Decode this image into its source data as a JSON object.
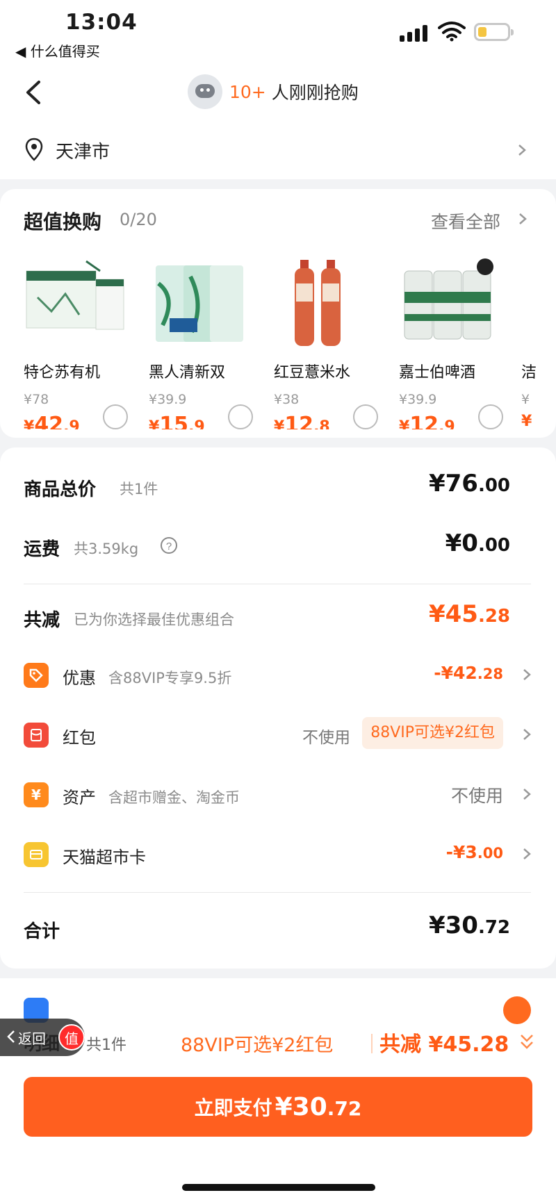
{
  "status_bar": {
    "time": "13:04",
    "back_app": "◀ 什么值得买"
  },
  "nav": {
    "count": "10+",
    "text": "人刚刚抢购"
  },
  "address": {
    "city": "天津市"
  },
  "exchange": {
    "title": "超值换购",
    "counter": "0/20",
    "view_all": "查看全部",
    "products": [
      {
        "name": "特仑苏有机",
        "orig": "¥78",
        "currency": "¥",
        "price_int": "42",
        "price_dec": ".9"
      },
      {
        "name": "黑人清新双",
        "orig": "¥39.9",
        "currency": "¥",
        "price_int": "15",
        "price_dec": ".9"
      },
      {
        "name": "红豆薏米水",
        "orig": "¥38",
        "currency": "¥",
        "price_int": "12",
        "price_dec": ".8"
      },
      {
        "name": "嘉士伯啤酒",
        "orig": "¥39.9",
        "currency": "¥",
        "price_int": "12",
        "price_dec": ".9"
      },
      {
        "name": "洁",
        "orig": "¥",
        "currency": "¥",
        "price_int": "",
        "price_dec": ""
      }
    ]
  },
  "summary": {
    "goods_total": {
      "label": "商品总价",
      "sub": "共1件",
      "amt_int": "¥76",
      "amt_dec": ".00"
    },
    "shipping": {
      "label": "运费",
      "sub": "共3.59kg",
      "amt_int": "¥0",
      "amt_dec": ".00"
    },
    "total_reduce": {
      "label": "共减",
      "sub": "已为你选择最佳优惠组合",
      "amt_int": "¥45",
      "amt_dec": ".28"
    },
    "discount": {
      "name": "优惠",
      "desc": "含88VIP专享9.5折",
      "val_int": "-¥42",
      "val_dec": ".28"
    },
    "redpacket": {
      "name": "红包",
      "no_use": "不使用",
      "tag": "88VIP可选¥2红包"
    },
    "assets": {
      "name": "资产",
      "desc": "含超市赠金、淘金币",
      "value": "不使用"
    },
    "tmall_card": {
      "name": "天猫超市卡",
      "val_int": "-¥3",
      "val_dec": ".00"
    },
    "total": {
      "label": "合计",
      "amt_int": "¥30",
      "amt_dec": ".72"
    }
  },
  "bottom": {
    "detail": "明细",
    "detail_count": "共1件",
    "promo": "88VIP可选¥2红包",
    "total_reduce": "共减 ¥45.28",
    "pay_label": "立即支付",
    "pay_amt_int": "¥30",
    "pay_amt_dec": ".72"
  },
  "float_return": {
    "text": "返回",
    "badge": "值"
  },
  "colors": {
    "accent": "#ff5a14",
    "accent_light": "#fdeee3",
    "button": "#ff5f1f"
  }
}
